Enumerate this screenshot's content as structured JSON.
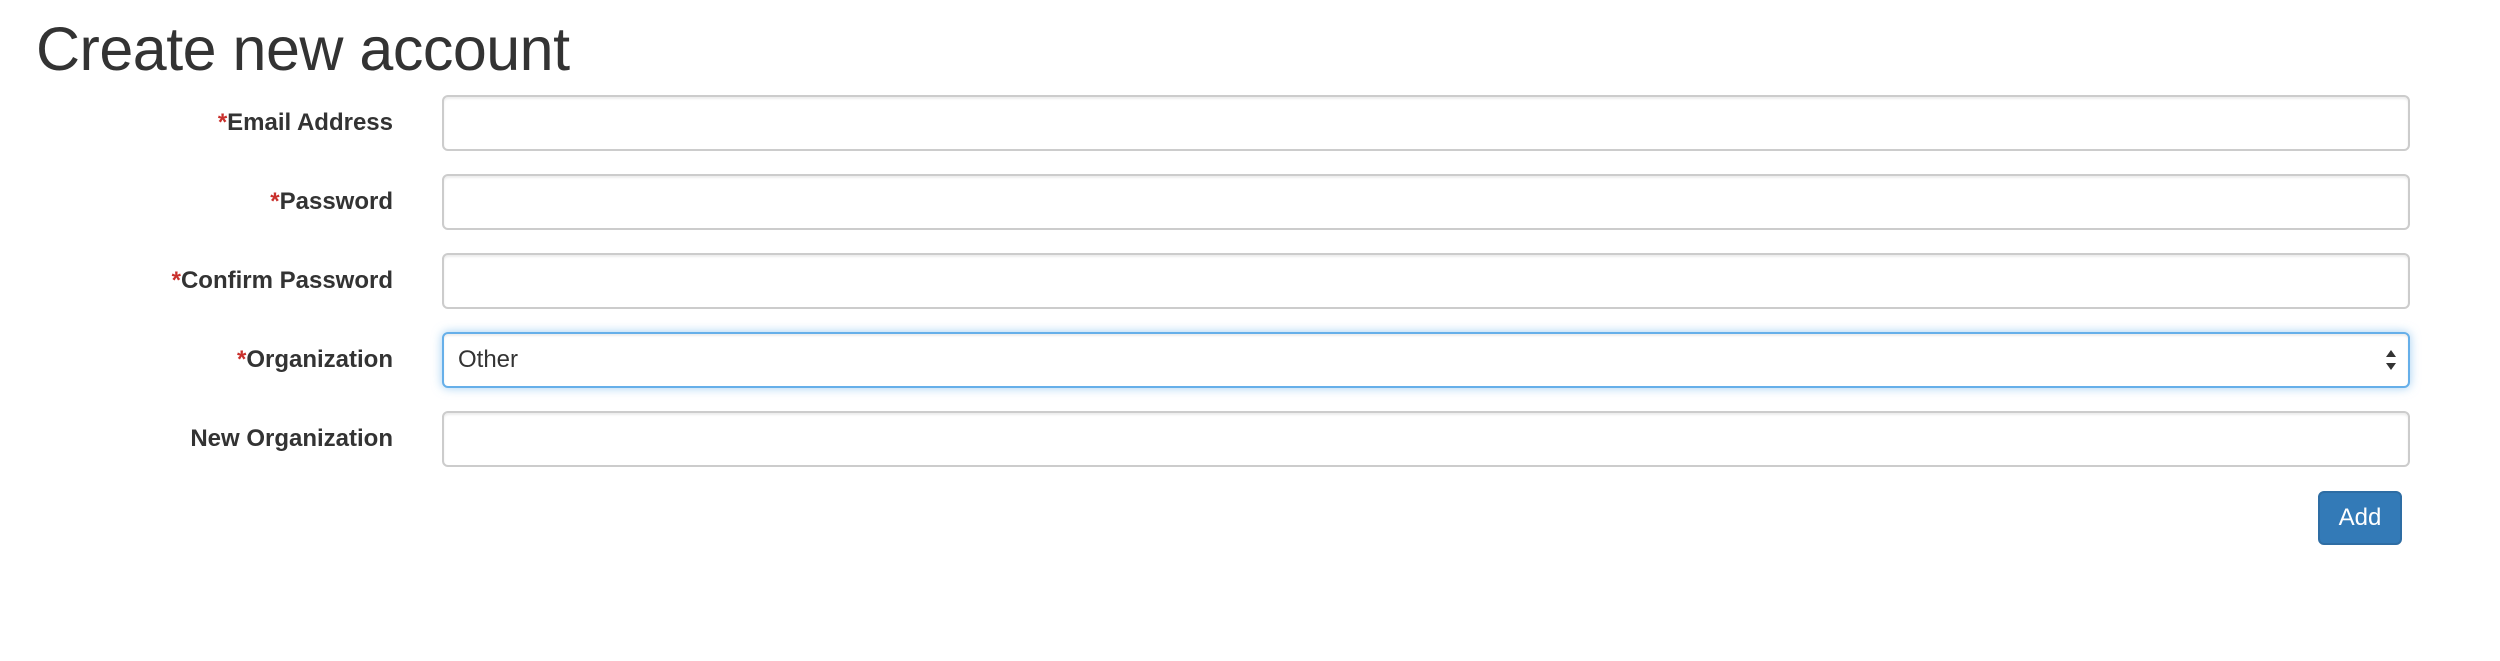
{
  "page": {
    "title": "Create new account"
  },
  "form": {
    "required_marker": "*",
    "fields": [
      {
        "label": "Email Address",
        "required": true,
        "value": "",
        "placeholder": ""
      },
      {
        "label": "Password",
        "required": true,
        "value": "",
        "placeholder": ""
      },
      {
        "label": "Confirm Password",
        "required": true,
        "value": "",
        "placeholder": ""
      },
      {
        "label": "Organization",
        "required": true,
        "selected": "Other"
      },
      {
        "label": "New Organization",
        "required": false,
        "value": "",
        "placeholder": ""
      }
    ],
    "submit_label": "Add"
  },
  "colors": {
    "required_marker": "#c9302c",
    "primary_button": "#337ab7",
    "focus_border": "#66afe9",
    "text": "#333333"
  },
  "icons": {
    "select_arrows": "sort-arrows-icon"
  }
}
